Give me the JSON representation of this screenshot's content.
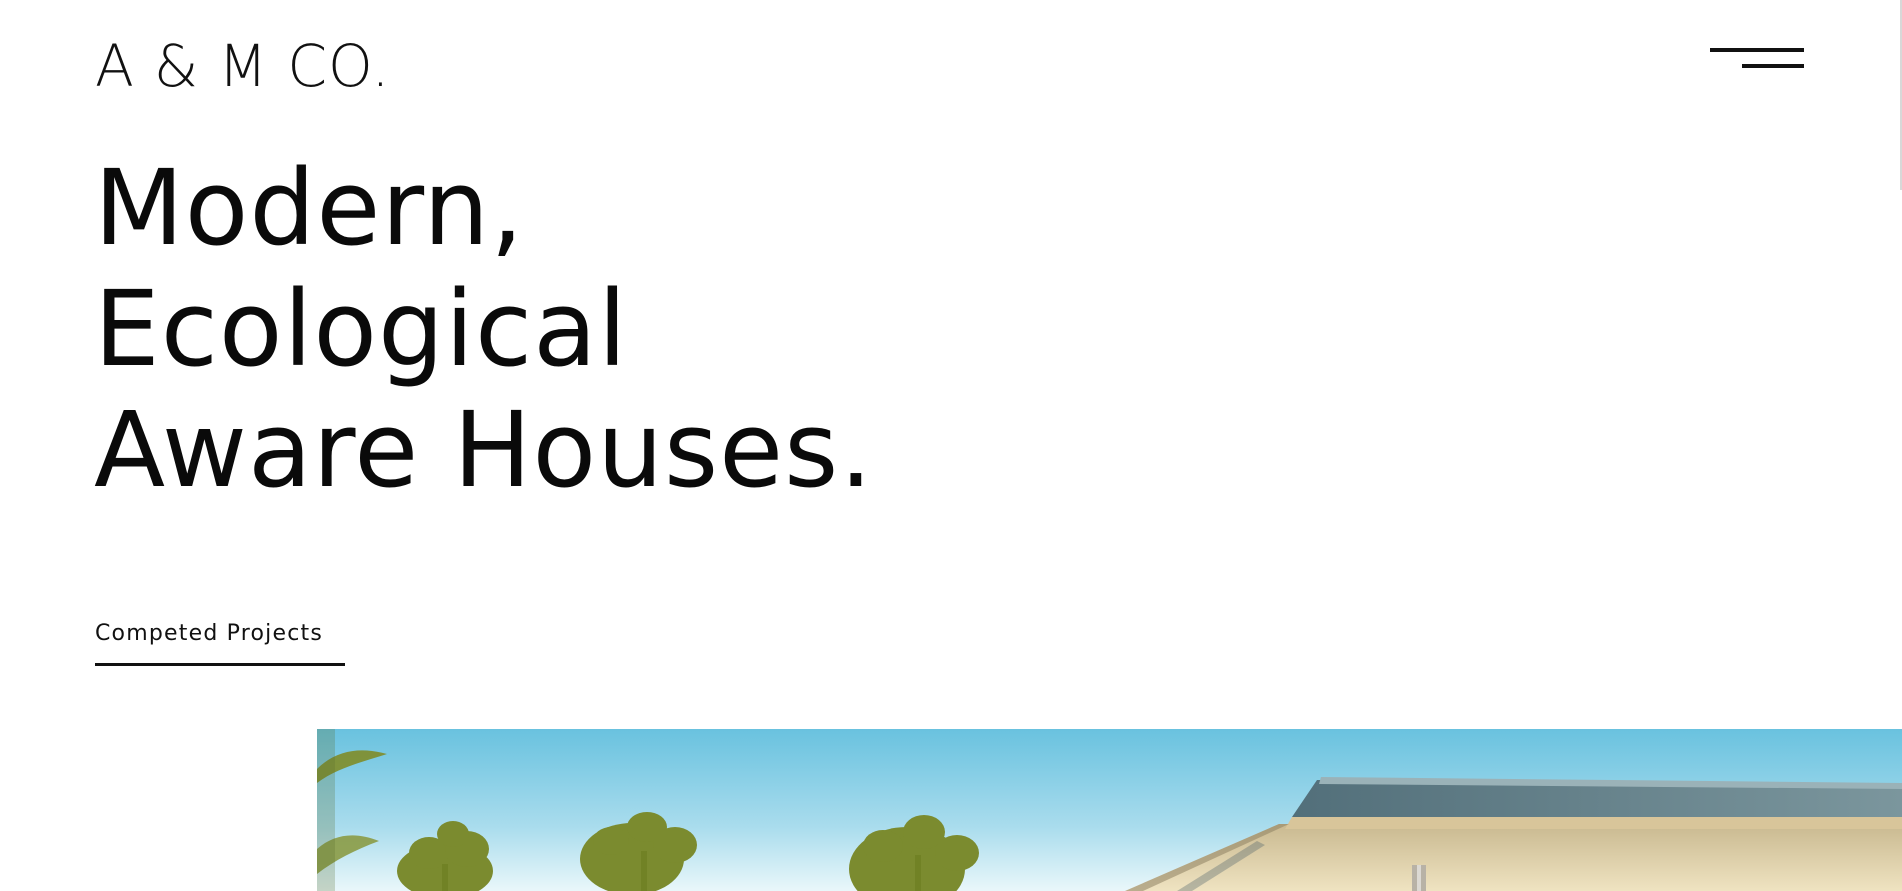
{
  "brand": {
    "logo": "A & M CO."
  },
  "header": {
    "menu_icon": "hamburger-menu-icon"
  },
  "hero": {
    "lines": [
      "Modern,",
      "Ecological",
      "Aware Houses."
    ]
  },
  "projects": {
    "link_label": "Competed Projects"
  },
  "image": {
    "subject": "house-photo"
  },
  "colors": {
    "background": "#ffffff",
    "text": "#000000",
    "sky": "#8fd0e8",
    "foliage": "#7f8f32",
    "facade": "#e3d4a8"
  }
}
